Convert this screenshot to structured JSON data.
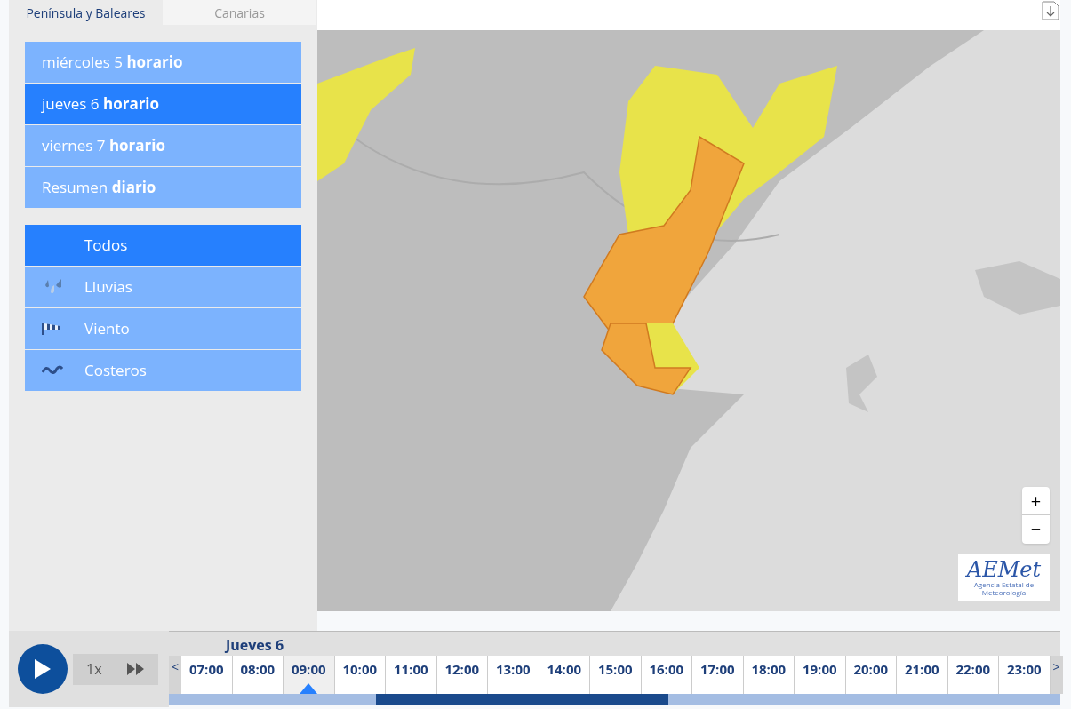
{
  "region_tabs": [
    {
      "label": "Península y Baleares",
      "selected": true
    },
    {
      "label": "Canarias",
      "selected": false
    }
  ],
  "days": [
    {
      "label": "miércoles 5 **horario**",
      "selected": false
    },
    {
      "label": "jueves 6 **horario**",
      "selected": true
    },
    {
      "label": "viernes 7 **horario**",
      "selected": false
    },
    {
      "label": "Resumen **diario**",
      "selected": false
    }
  ],
  "phenomena": [
    {
      "label": "Todos",
      "kind": "all",
      "selected": true
    },
    {
      "label": "Lluvias",
      "kind": "rain",
      "selected": false
    },
    {
      "label": "Viento",
      "kind": "wind",
      "selected": false
    },
    {
      "label": "Costeros",
      "kind": "coast",
      "selected": false
    }
  ],
  "map": {
    "kind": "picture",
    "zoom_in": "+",
    "zoom_out": "−",
    "logo": {
      "mark": "AEMet",
      "caption": "Agencia Estatal de Meteorología"
    }
  },
  "player": {
    "speed": "1x",
    "playing": false
  },
  "timeline": {
    "day": "Jueves 6",
    "prev": "<",
    "next": ">",
    "hours": [
      {
        "label": "07:00",
        "selected": false
      },
      {
        "label": "08:00",
        "selected": false
      },
      {
        "label": "09:00",
        "selected": true
      },
      {
        "label": "10:00",
        "selected": false
      },
      {
        "label": "11:00",
        "selected": false
      },
      {
        "label": "12:00",
        "selected": false
      },
      {
        "label": "13:00",
        "selected": false
      },
      {
        "label": "14:00",
        "selected": false
      },
      {
        "label": "15:00",
        "selected": false
      },
      {
        "label": "16:00",
        "selected": false
      },
      {
        "label": "17:00",
        "selected": false
      },
      {
        "label": "18:00",
        "selected": false
      },
      {
        "label": "19:00",
        "selected": false
      },
      {
        "label": "20:00",
        "selected": false
      },
      {
        "label": "21:00",
        "selected": false
      },
      {
        "label": "22:00",
        "selected": false
      },
      {
        "label": "23:00",
        "selected": false
      }
    ]
  }
}
